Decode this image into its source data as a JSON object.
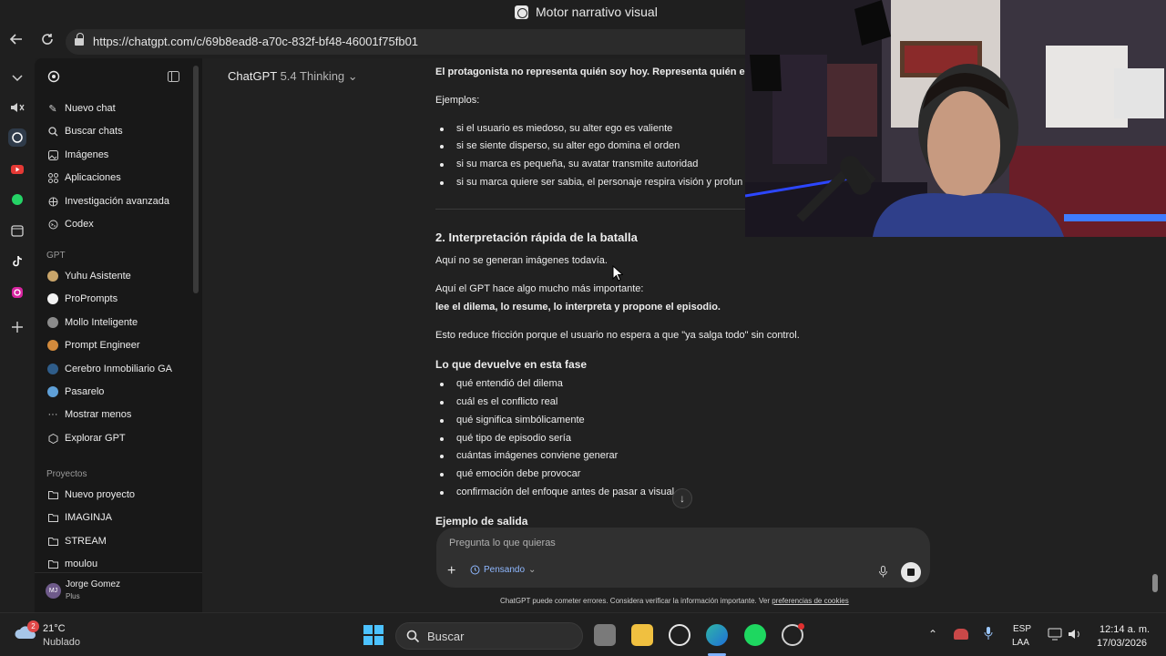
{
  "browser": {
    "tab_title": "Motor narrativo visual",
    "url": "https://chatgpt.com/c/69b8ead8-a70c-832f-bf48-46001f75fb01"
  },
  "sidebar": {
    "items": [
      {
        "label": "Nuevo chat",
        "icon": "new-chat-icon"
      },
      {
        "label": "Buscar chats",
        "icon": "search-icon"
      },
      {
        "label": "Imágenes",
        "icon": "images-icon"
      },
      {
        "label": "Aplicaciones",
        "icon": "apps-icon"
      },
      {
        "label": "Investigación avanzada",
        "icon": "research-icon"
      },
      {
        "label": "Codex",
        "icon": "codex-icon"
      }
    ],
    "gpt_section": "GPT",
    "gpts": [
      {
        "label": "Yuhu Asistente",
        "color": "#c9a56a"
      },
      {
        "label": "ProPrompts",
        "color": "#f2f2f2"
      },
      {
        "label": "Mollo Inteligente",
        "color": "#8c8c8c"
      },
      {
        "label": "Prompt Engineer",
        "color": "#d28a3c"
      },
      {
        "label": "Cerebro Inmobiliario GA",
        "color": "#2f5d8a"
      },
      {
        "label": "Pasarelo",
        "color": "#5fa0d8"
      }
    ],
    "show_less": "Mostrar menos",
    "explore": "Explorar GPT",
    "projects_section": "Proyectos",
    "projects": [
      "Nuevo proyecto",
      "IMAGINJA",
      "STREAM",
      "moulou"
    ],
    "user_name": "Jorge Gomez",
    "user_plan": "Plus",
    "user_initials": "MJ"
  },
  "header": {
    "model": "ChatGPT",
    "version": "5.4 Thinking"
  },
  "content": {
    "intro_bold": "El protagonista no representa quién soy hoy. Representa quién est",
    "examples_label": "Ejemplos:",
    "examples": [
      "si el usuario es miedoso, su alter ego es valiente",
      "si se siente disperso, su alter ego domina el orden",
      "si su marca es pequeña, su avatar transmite autoridad",
      "si su marca quiere ser sabia, el personaje respira visión y profun"
    ],
    "section2_title": "2. Interpretación rápida de la batalla",
    "p1": "Aquí no se generan imágenes todavía.",
    "p2": "Aquí el GPT hace algo mucho más importante:",
    "p2_bold": "lee el dilema, lo resume, lo interpreta y propone el episodio.",
    "p3": "Esto reduce fricción porque el usuario no espera a que \"ya salga todo\" sin control.",
    "returns_title": "Lo que devuelve en esta fase",
    "returns": [
      "qué entendió del dilema",
      "cuál es el conflicto real",
      "qué significa simbólicamente",
      "qué tipo de episodio sería",
      "cuántas imágenes conviene generar",
      "qué emoción debe provocar",
      "confirmación del enfoque antes de pasar a visual"
    ],
    "example_output": "Ejemplo de salida"
  },
  "composer": {
    "placeholder": "Pregunta lo que quieras",
    "mode": "Pensando",
    "disclaimer": "ChatGPT puede cometer errores. Considera verificar la información importante. Ver",
    "disclaimer_link": "preferencias de cookies"
  },
  "taskbar": {
    "weather_temp": "21°C",
    "weather_desc": "Nublado",
    "weather_badge": "2",
    "search": "Buscar",
    "lang": "ESP",
    "lang2": "LAA",
    "time": "12:14 a. m.",
    "date": "17/03/2026"
  }
}
